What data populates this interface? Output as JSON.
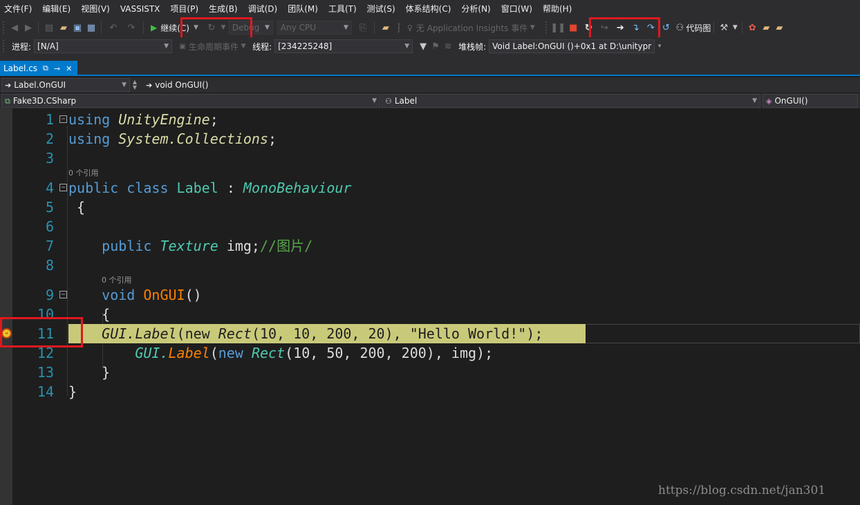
{
  "menu": [
    "文件(F)",
    "编辑(E)",
    "视图(V)",
    "VASSISTX",
    "项目(P)",
    "生成(B)",
    "调试(D)",
    "团队(M)",
    "工具(T)",
    "测试(S)",
    "体系结构(C)",
    "分析(N)",
    "窗口(W)",
    "帮助(H)"
  ],
  "toolbar": {
    "continue_label": "继续(C)",
    "config": "Debug",
    "platform": "Any CPU",
    "app_insights": "无 Application Insights 事件",
    "code_map": "代码图"
  },
  "debug_bar": {
    "process_label": "进程:",
    "process_value": "[N/A]",
    "lifecycle_label": "生命周期事件",
    "thread_label": "线程:",
    "thread_value": "[234225248]",
    "stack_label": "堆栈帧:",
    "stack_value": "Void Label:OnGUI ()+0x1 at D:\\unitypr"
  },
  "tab": {
    "name": "Label.cs"
  },
  "nav": {
    "member_scope": "Label.OnGUI",
    "member": "void OnGUI()",
    "project": "Fake3D.CSharp",
    "class": "Label",
    "method": "OnGUI()"
  },
  "code": {
    "line_numbers": [
      "1",
      "2",
      "3",
      "4",
      "5",
      "6",
      "7",
      "8",
      "9",
      "10",
      "11",
      "12",
      "13",
      "14"
    ],
    "refs_label": "0 个引用",
    "l1_kw": "using",
    "l1_ns": "UnityEngine",
    "l1_end": ";",
    "l2_kw": "using",
    "l2_ns": "System.Collections",
    "l2_end": ";",
    "l4_kw": "public class",
    "l4_name": "Label",
    "l4_colon": ":",
    "l4_base": "MonoBehaviour",
    "l5": "{",
    "l7_kw": "public",
    "l7_type": "Texture",
    "l7_rest": "img;",
    "l7_comment": "//图片/",
    "l9_kw": "void",
    "l9_fn": "OnGUI",
    "l9_paren": "()",
    "l10": "{",
    "l11_a": "GUI.Label",
    "l11_b": "(new",
    "l11_c": "Rect",
    "l11_d": "(10, 10, 200, 20), \"Hello World!\");",
    "l12_a": "GUI.",
    "l12_b": "Label",
    "l12_c": "(",
    "l12_d": "new",
    "l12_e": "Rect",
    "l12_f": "(10, 50, 200, 200), img);",
    "l13": "}",
    "l14": "}"
  },
  "watermark": "https://blog.csdn.net/jan301"
}
